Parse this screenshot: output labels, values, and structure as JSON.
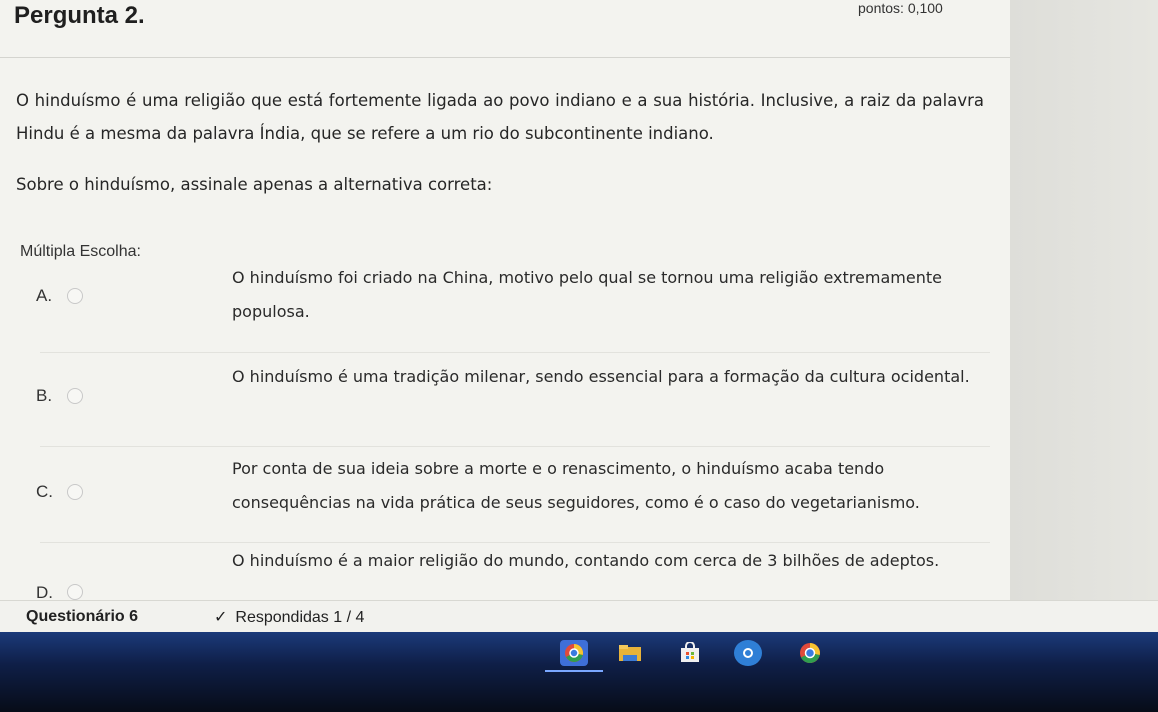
{
  "question": {
    "title": "Pergunta 2.",
    "points": "pontos: 0,100",
    "paragraph1": "O hinduísmo é uma religião que está fortemente ligada ao povo indiano e a sua história. Inclusive, a raiz da palavra Hindu é a mesma da palavra Índia, que se refere a um rio do subcontinente indiano.",
    "paragraph2": "Sobre o hinduísmo, assinale apenas a alternativa correta:",
    "type_label": "Múltipla Escolha:"
  },
  "options": [
    {
      "letter": "A.",
      "text": "O hinduísmo foi criado na China, motivo pelo qual se tornou uma religião extremamente populosa."
    },
    {
      "letter": "B.",
      "text": "O hinduísmo é uma tradição milenar, sendo essencial para a formação da cultura ocidental."
    },
    {
      "letter": "C.",
      "text": "Por conta de sua ideia sobre a morte e o renascimento, o hinduísmo acaba tendo consequências na vida prática de seus seguidores, como é o caso do vegetarianismo."
    },
    {
      "letter": "D.",
      "text": "O hinduísmo é a maior religião do mundo, contando com cerca de 3 bilhões de adeptos."
    }
  ],
  "footer": {
    "quiz_name": "Questionário 6",
    "check_glyph": "✓",
    "answered": "Respondidas 1 / 4"
  },
  "taskbar": {
    "icons": [
      {
        "name": "chrome-icon",
        "color": "#3e6fd8"
      },
      {
        "name": "file-explorer-icon",
        "color": "#e8b33a"
      },
      {
        "name": "store-icon",
        "color": "#4a72c8"
      },
      {
        "name": "app-icon",
        "color": "#2f7fd6"
      },
      {
        "name": "chrome-profile-icon",
        "color": "#4a78d4"
      }
    ]
  }
}
